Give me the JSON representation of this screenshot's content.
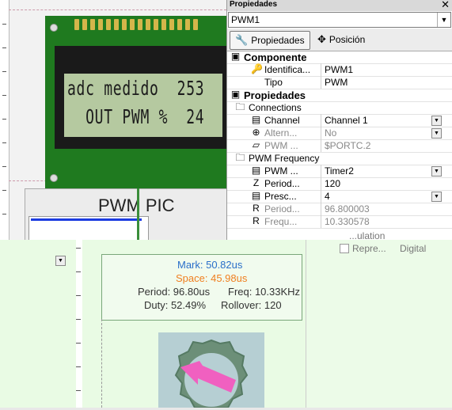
{
  "lcd": {
    "line1": "adc medido  253",
    "line2": "  OUT PWM %  24"
  },
  "component_label": "PWM PIC",
  "properties_panel": {
    "title": "Propiedades",
    "close_icon": "close-icon",
    "selected_component": "PWM1",
    "tabs": [
      {
        "label": "Propiedades",
        "icon": "wrench-icon"
      },
      {
        "label": "Posición",
        "icon": "move-icon"
      }
    ],
    "rows": [
      {
        "kind": "section",
        "label": "Componente",
        "icon": "component-icon"
      },
      {
        "kind": "prop",
        "label": "Identifica...",
        "value": "PWM1",
        "icon": "key-icon"
      },
      {
        "kind": "prop",
        "label": "Tipo",
        "value": "PWM",
        "icon": ""
      },
      {
        "kind": "section",
        "label": "Propiedades",
        "icon": "component-icon"
      },
      {
        "kind": "group",
        "label": "Connections",
        "icon": "folder-icon"
      },
      {
        "kind": "prop",
        "label": "Channel",
        "value": "Channel 1",
        "icon": "list-icon",
        "dropdown": true
      },
      {
        "kind": "prop",
        "label": "Altern...",
        "value": "No",
        "icon": "pin-icon",
        "dropdown": true,
        "muted": true
      },
      {
        "kind": "prop",
        "label": "PWM ...",
        "value": "$PORTC.2",
        "icon": "port-icon",
        "muted": true
      },
      {
        "kind": "group",
        "label": "PWM Frequency",
        "icon": "folder-icon"
      },
      {
        "kind": "prop",
        "label": "PWM ...",
        "value": "Timer2",
        "icon": "list-icon",
        "dropdown": true
      },
      {
        "kind": "prop",
        "label": "Period...",
        "value": "120",
        "icon": "integer-icon"
      },
      {
        "kind": "prop",
        "label": "Presc...",
        "value": "4",
        "icon": "list-icon",
        "dropdown": true
      },
      {
        "kind": "prop",
        "label": "Period...",
        "value": "96.800003",
        "icon": "real-icon",
        "muted": true
      },
      {
        "kind": "prop",
        "label": "Frequ...",
        "value": "10.330578",
        "icon": "real-icon",
        "muted": true
      }
    ]
  },
  "tree_fragment": {
    "line1": "...ulation",
    "line2": "Repre...",
    "line3": "Digital"
  },
  "pwm_stats": {
    "mark": "Mark: 50.82us",
    "space": "Space: 45.98us",
    "period": "Period: 96.80us",
    "freq": "Freq: 10.33KHz",
    "duty": "Duty: 52.49%",
    "rollover": "Rollover: 120"
  },
  "colors": {
    "mark": "#2a6fc9",
    "space": "#f07f20",
    "board": "#1f7a1f",
    "lcd_screen": "#b5c9a0",
    "overlay_bg": "#e9fbe4",
    "dial_arrow": "#f060c0"
  }
}
